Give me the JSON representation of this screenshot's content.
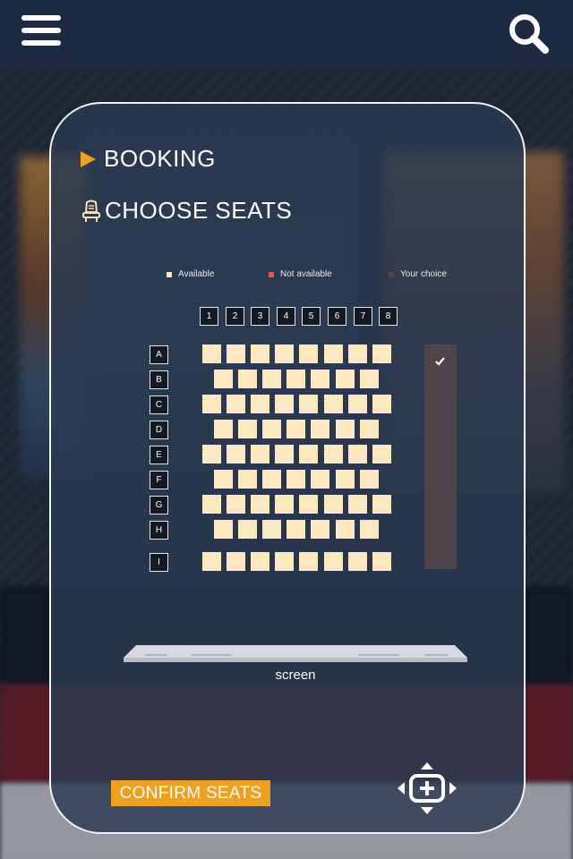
{
  "header": {
    "menu_icon": "hamburger-menu-icon",
    "search_icon": "search-icon",
    "background_color": "#1c2a44"
  },
  "booking": {
    "title": "BOOKING",
    "subtitle": "CHOOSE SEATS",
    "accent_color": "#f0a020"
  },
  "legend": {
    "available": {
      "label": "Available",
      "color": "#fde8bf"
    },
    "not_available": {
      "label": "Not available",
      "color": "#ef4a5d"
    },
    "your_choice": {
      "label": "Your choice",
      "color": "#4e4449"
    }
  },
  "seating": {
    "columns": [
      "1",
      "2",
      "3",
      "4",
      "5",
      "6",
      "7",
      "8"
    ],
    "rows": [
      {
        "label": "A",
        "seats": 8
      },
      {
        "label": "B",
        "seats": 7
      },
      {
        "label": "C",
        "seats": 8
      },
      {
        "label": "D",
        "seats": 7
      },
      {
        "label": "E",
        "seats": 8
      },
      {
        "label": "F",
        "seats": 7
      },
      {
        "label": "G",
        "seats": 8
      },
      {
        "label": "H",
        "seats": 7
      },
      {
        "label": "I",
        "seats": 8
      }
    ],
    "selected_indicator": "checkmark-icon"
  },
  "screen_label": "screen",
  "confirm_label": "CONFIRM SEATS",
  "move_icon": "move-arrows-icon"
}
